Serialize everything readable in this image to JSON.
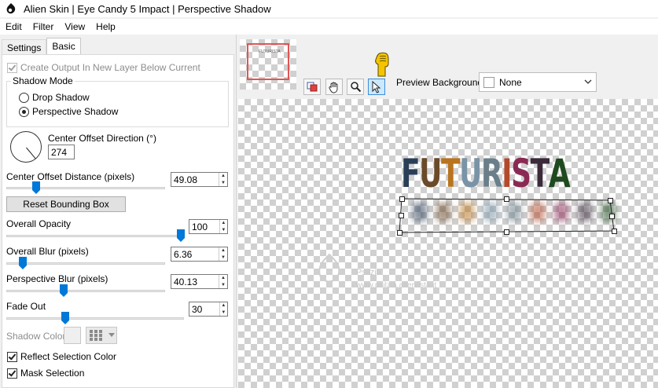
{
  "window": {
    "title": "Alien Skin | Eye Candy 5 Impact | Perspective Shadow"
  },
  "menu": [
    "Edit",
    "Filter",
    "View",
    "Help"
  ],
  "tabs": {
    "settings": "Settings",
    "basic": "Basic"
  },
  "basic": {
    "create_output_label": "Create Output In New Layer Below Current",
    "shadow_mode_title": "Shadow Mode",
    "drop_shadow_label": "Drop Shadow",
    "perspective_shadow_label": "Perspective Shadow",
    "selected_mode": "Perspective Shadow",
    "center_offset_direction_label": "Center Offset Direction (°)",
    "center_offset_direction_value": "274",
    "center_offset_distance_label": "Center Offset Distance (pixels)",
    "center_offset_distance_value": "49.08",
    "reset_bounding_box_label": "Reset Bounding Box",
    "overall_opacity_label": "Overall Opacity",
    "overall_opacity_value": "100",
    "overall_blur_label": "Overall Blur (pixels)",
    "overall_blur_value": "6.36",
    "perspective_blur_label": "Perspective Blur (pixels)",
    "perspective_blur_value": "40.13",
    "fade_out_label": "Fade Out",
    "fade_out_value": "30",
    "shadow_color_label": "Shadow Color",
    "reflect_selection_color_label": "Reflect Selection Color",
    "mask_selection_label": "Mask Selection",
    "reflect_selection_color_checked": true,
    "mask_selection_checked": true
  },
  "preview": {
    "background_label": "Preview Background:",
    "background_value": "None",
    "canvas_text": "FUTURISTA",
    "letter_colors": [
      "#2b3e57",
      "#6b4a2a",
      "#b8741f",
      "#7a93a6",
      "#6a7f89",
      "#b34a2c",
      "#8a2a54",
      "#3a2a3a",
      "#1f4a1f"
    ],
    "watermark_text": "Psilzia",
    "watermark_url": "www.psilzia.altervista.it"
  },
  "colors": {
    "accent": "#0078d7",
    "active_tool": "#cce8ff",
    "thumb_frame": "#e05555"
  }
}
